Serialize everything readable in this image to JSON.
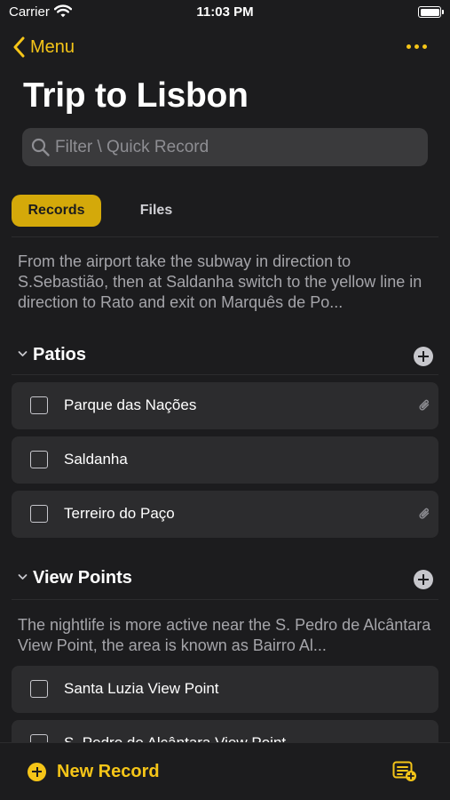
{
  "status_bar": {
    "carrier": "Carrier",
    "time": "11:03 PM"
  },
  "nav": {
    "back_label": "Menu"
  },
  "title": "Trip to Lisbon",
  "search": {
    "placeholder": "Filter \\ Quick Record"
  },
  "tabs": [
    {
      "label": "Records",
      "selected": true
    },
    {
      "label": "Files",
      "selected": false
    }
  ],
  "intro_note": "From the airport take the subway in direction to S.Sebastião, then at Saldanha switch to the yellow line in direction to Rato and exit on Marquês de Po...",
  "sections": [
    {
      "title": "Patios",
      "items": [
        {
          "label": "Parque das Nações",
          "has_attachment": true
        },
        {
          "label": "Saldanha",
          "has_attachment": false
        },
        {
          "label": "Terreiro do Paço",
          "has_attachment": true
        }
      ]
    },
    {
      "title": "View Points",
      "note": "The nightlife is more active near the S. Pedro de Alcântara View Point, the area is known as Bairro Al...",
      "items": [
        {
          "label": "Santa Luzia View Point",
          "has_attachment": false
        },
        {
          "label": "S. Pedro de Alcântara View Point",
          "has_attachment": false
        }
      ]
    }
  ],
  "bottom_bar": {
    "new_record_label": "New Record"
  },
  "colors": {
    "accent": "#f5c518",
    "background": "#1c1c1e",
    "row": "#2c2c2e"
  }
}
